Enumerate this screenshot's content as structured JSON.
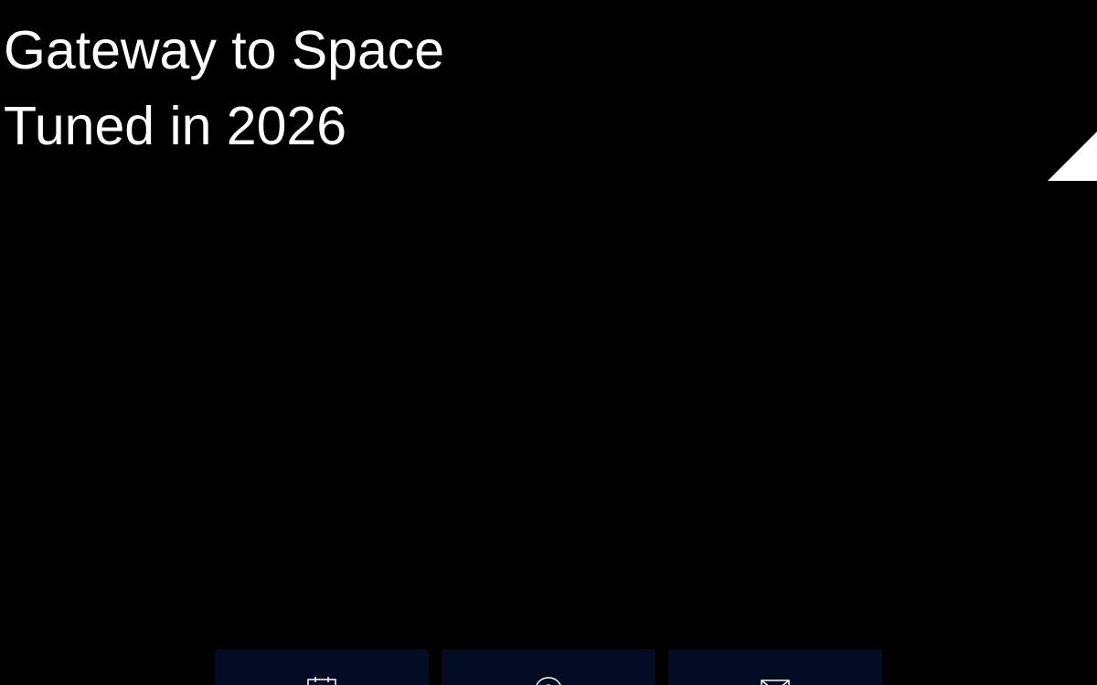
{
  "hero": {
    "line1": "Gateway to Space",
    "line2": "Tuned in 2026"
  },
  "colors": {
    "background": "#000000",
    "text": "#ffffff",
    "card": "#030c22"
  },
  "actions": [
    {
      "icon": "calendar-icon"
    },
    {
      "icon": "location-pin-icon"
    },
    {
      "icon": "mail-icon"
    }
  ]
}
